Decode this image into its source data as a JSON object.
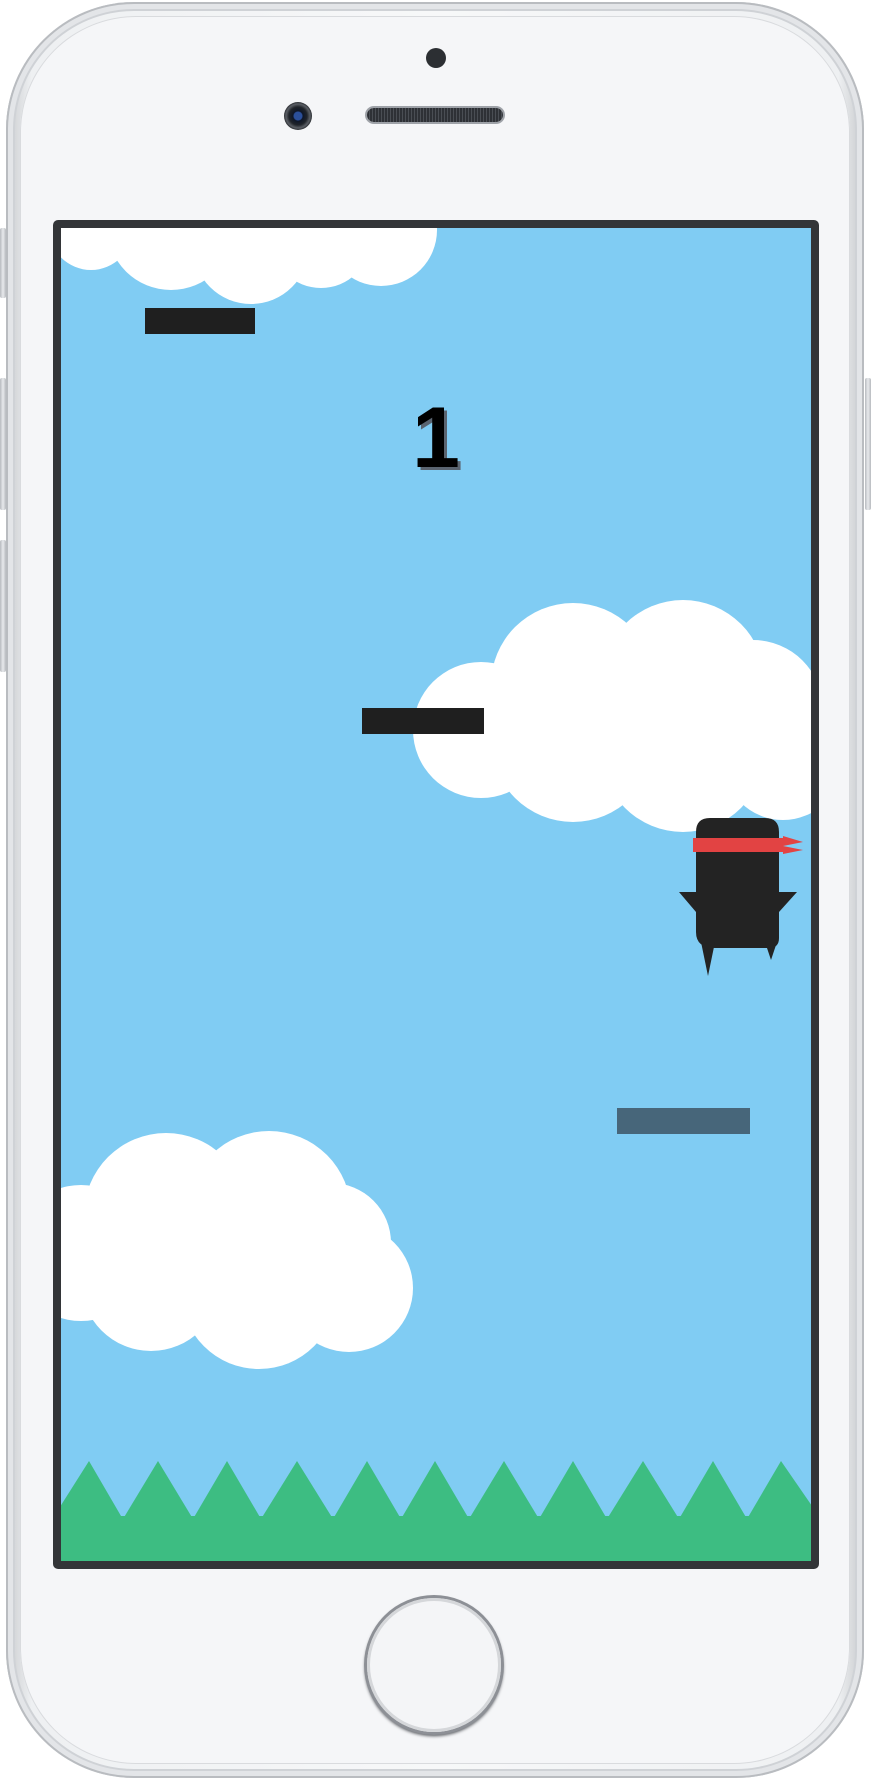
{
  "game": {
    "score": "1",
    "colors": {
      "sky": "#80ccf3",
      "cloud": "#ffffff",
      "platform": "#1f1f1f",
      "platform_faded": "#47667a",
      "grass": "#3dbd82",
      "ninja_body": "#232323",
      "headband": "#e24343"
    },
    "entities": {
      "player": "ninja",
      "hazard": "grass-spikes",
      "platforms": [
        "platform",
        "platform",
        "platform-faded"
      ],
      "background": [
        "cloud",
        "cloud",
        "cloud"
      ]
    }
  },
  "device": {
    "controls": [
      "home-button"
    ],
    "icons": [
      "front-camera-icon",
      "proximity-sensor-icon",
      "earpiece-speaker-icon"
    ]
  }
}
